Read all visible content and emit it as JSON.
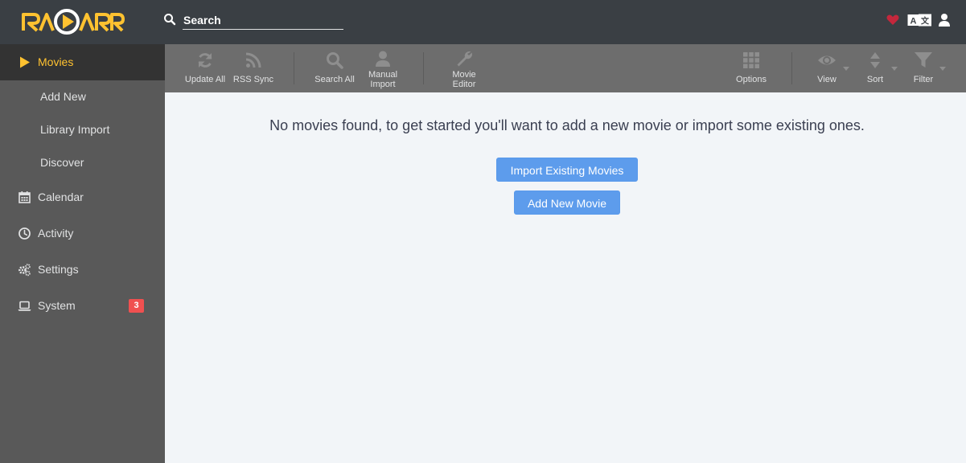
{
  "app": {
    "logo_text": "RADARR",
    "brand_color": "#ffc230",
    "header_bg": "#3a3f44"
  },
  "search": {
    "placeholder": "Search",
    "value": ""
  },
  "header_icons": [
    "heart-icon",
    "translate-icon",
    "user-icon"
  ],
  "sidebar": {
    "items": [
      {
        "label": "Movies",
        "icon": "play-icon",
        "active": true
      },
      {
        "label": "Add New"
      },
      {
        "label": "Library Import"
      },
      {
        "label": "Discover"
      },
      {
        "label": "Calendar",
        "icon": "calendar-icon"
      },
      {
        "label": "Activity",
        "icon": "clock-icon"
      },
      {
        "label": "Settings",
        "icon": "cogs-icon"
      },
      {
        "label": "System",
        "icon": "laptop-icon",
        "badge": "3"
      }
    ]
  },
  "toolbar": {
    "update_all": "Update All",
    "rss_sync": "RSS Sync",
    "search_all": "Search All",
    "manual_import_1": "Manual",
    "manual_import_2": "Import",
    "movie_editor_1": "Movie",
    "movie_editor_2": "Editor",
    "options": "Options",
    "view": "View",
    "sort": "Sort",
    "filter": "Filter"
  },
  "main": {
    "empty_message": "No movies found, to get started you'll want to add a new movie or import some existing ones.",
    "import_button": "Import Existing Movies",
    "add_button": "Add New Movie"
  }
}
